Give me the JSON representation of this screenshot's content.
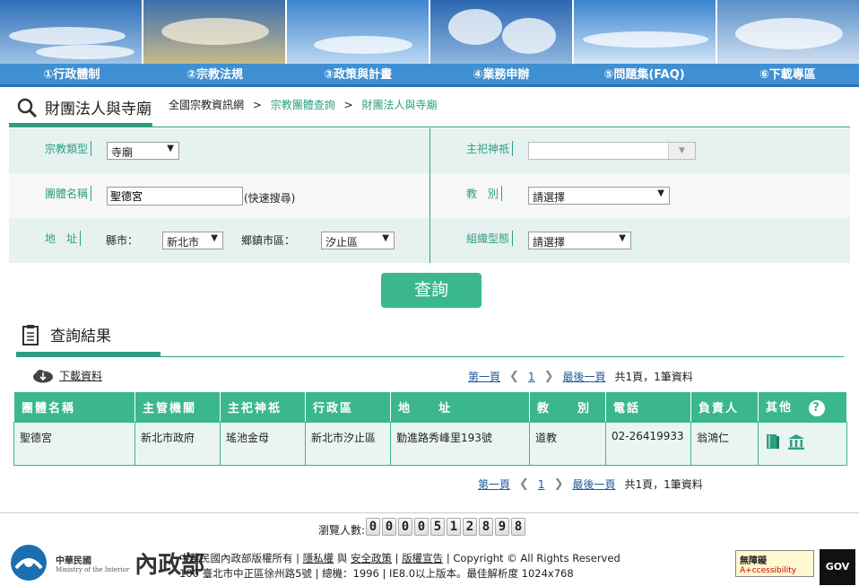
{
  "nav": {
    "items": [
      "①行政體制",
      "②宗教法規",
      "③政策與計畫",
      "④業務申辦",
      "⑤問題集(FAQ)",
      "⑥下載專區"
    ]
  },
  "page": {
    "title": "財團法人與寺廟",
    "breadcrumb": [
      "全國宗教資訊網",
      "宗教團體查詢",
      "財團法人與寺廟"
    ],
    "breadcrumb_sep": ">"
  },
  "form": {
    "religion_type_label": "宗教類型",
    "religion_type_value": "寺廟",
    "deity_label": "主祀神祇",
    "deity_value": "",
    "group_name_label": "團體名稱",
    "group_name_value": "聖德宮",
    "quick_search_hint": "(快速搜尋)",
    "sect_label": "教　別",
    "sect_value": "請選擇",
    "address_label": "地　址",
    "city_label": "縣市：",
    "city_value": "新北市",
    "district_label": "鄉鎮市區：",
    "district_value": "汐止區",
    "org_type_label": "組織型態",
    "org_type_value": "請選擇"
  },
  "query_button": "查詢",
  "results": {
    "title": "查詢結果",
    "download_label": "下載資料",
    "pager": {
      "first": "第一頁",
      "current": "1",
      "last": "最後一頁",
      "summary": "共1頁，1筆資料"
    },
    "columns": [
      "團體名稱",
      "主管機關",
      "主祀神祇",
      "行政區",
      "地　　址",
      "教　　別",
      "電話",
      "負責人",
      "其他"
    ],
    "rows": [
      {
        "name": "聖德宮",
        "authority": "新北市政府",
        "deity": "瑤池金母",
        "district": "新北市汐止區",
        "address": "勤進路秀峰里193號",
        "sect": "道教",
        "phone": "02-26419933",
        "owner": "翁鴻仁"
      }
    ]
  },
  "footer": {
    "visitor_label": "瀏覽人數:",
    "visitor_digits": [
      "0",
      "0",
      "0",
      "0",
      "5",
      "1",
      "2",
      "8",
      "9",
      "8"
    ],
    "org_name": "中華民國",
    "org_name_en": "Ministry of the Interior",
    "org_logo_text": "內政部",
    "copyright_line1_pre": "中華民國內政部版權所有 | ",
    "privacy": "隱私權",
    "and": " 與 ",
    "security": "安全政策",
    "sep": " | ",
    "copyright_notice": "版權宣告",
    "copyright_line1_post": " | Copyright © All Rights Reserved",
    "copyright_line2": "100 臺北市中正區徐州路5號 | 總機：1996 | IE8.0以上版本。最佳解析度 1024x768",
    "accessibility_label": "無障礙",
    "accessibility_sub": "A+ccessibility",
    "gov_label": "GOV"
  },
  "colors": {
    "nav_bg": "#3f8fd2",
    "accent": "#3bb78f",
    "label_green": "#2e9e82"
  }
}
